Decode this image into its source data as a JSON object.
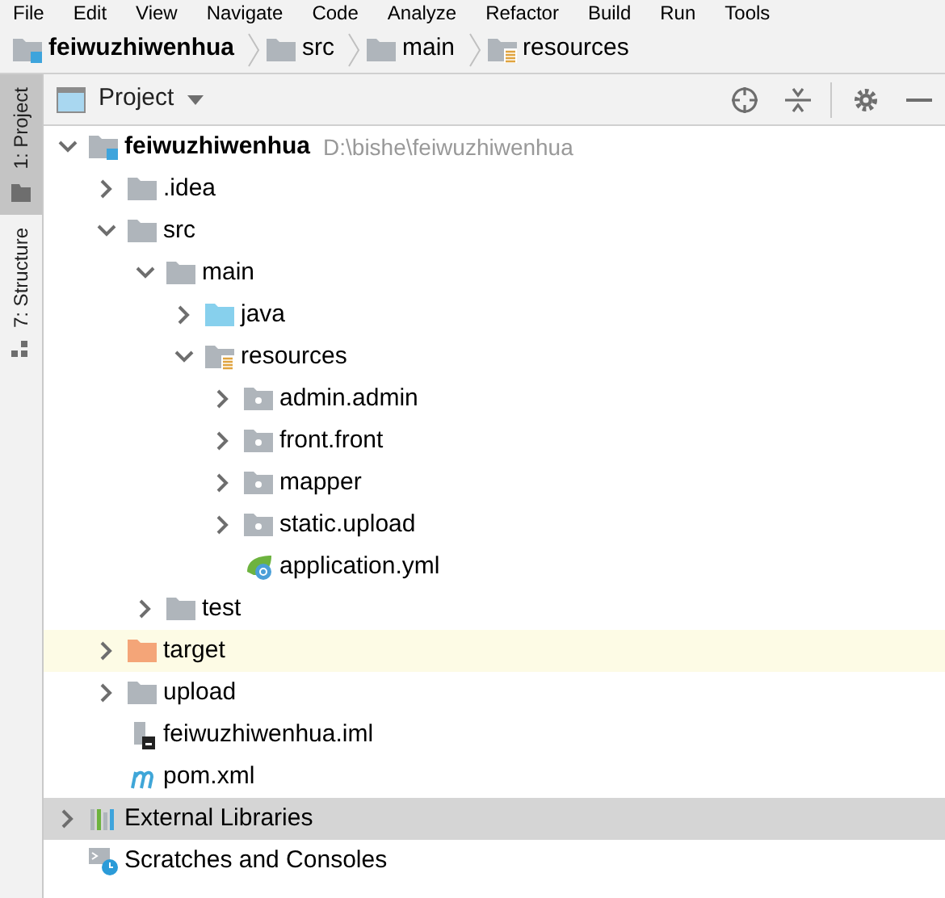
{
  "menu_bar": [
    "File",
    "Edit",
    "View",
    "Navigate",
    "Code",
    "Analyze",
    "Refactor",
    "Build",
    "Run",
    "Tools"
  ],
  "breadcrumbs": [
    {
      "label": "feiwuzhiwenhua",
      "kind": "module"
    },
    {
      "label": "src",
      "kind": "folder"
    },
    {
      "label": "main",
      "kind": "folder"
    },
    {
      "label": "resources",
      "kind": "resources"
    }
  ],
  "side_tabs": [
    {
      "label": "1: Project",
      "selected": true
    },
    {
      "label": "7: Structure",
      "selected": false
    }
  ],
  "panel": {
    "title": "Project"
  },
  "tree": [
    {
      "label": "feiwuzhiwenhua",
      "path": "D:\\bishe\\feiwuzhiwenhua",
      "kind": "module",
      "expanded": true,
      "selected": false,
      "highlighted": false,
      "children": [
        {
          "label": ".idea",
          "kind": "folder",
          "expanded": false,
          "selected": false,
          "highlighted": false
        },
        {
          "label": "src",
          "kind": "folder",
          "expanded": true,
          "selected": false,
          "highlighted": false,
          "children": [
            {
              "label": "main",
              "kind": "folder",
              "expanded": true,
              "selected": false,
              "highlighted": false,
              "children": [
                {
                  "label": "java",
                  "kind": "source",
                  "expanded": false,
                  "selected": false,
                  "highlighted": false
                },
                {
                  "label": "resources",
                  "kind": "resources",
                  "expanded": true,
                  "selected": false,
                  "highlighted": false,
                  "children": [
                    {
                      "label": "admin.admin",
                      "kind": "package",
                      "expanded": false,
                      "selected": false,
                      "highlighted": false
                    },
                    {
                      "label": "front.front",
                      "kind": "package",
                      "expanded": false,
                      "selected": false,
                      "highlighted": false
                    },
                    {
                      "label": "mapper",
                      "kind": "package",
                      "expanded": false,
                      "selected": false,
                      "highlighted": false
                    },
                    {
                      "label": "static.upload",
                      "kind": "package",
                      "expanded": false,
                      "selected": false,
                      "highlighted": false
                    },
                    {
                      "label": "application.yml",
                      "kind": "spring",
                      "selected": false,
                      "highlighted": false
                    }
                  ]
                }
              ]
            },
            {
              "label": "test",
              "kind": "folder",
              "expanded": false,
              "selected": false,
              "highlighted": false
            }
          ]
        },
        {
          "label": "target",
          "kind": "excluded",
          "expanded": false,
          "selected": false,
          "highlighted": true
        },
        {
          "label": "upload",
          "kind": "folder",
          "expanded": false,
          "selected": false,
          "highlighted": false
        },
        {
          "label": "feiwuzhiwenhua.iml",
          "kind": "iml",
          "selected": false,
          "highlighted": false
        },
        {
          "label": "pom.xml",
          "kind": "maven",
          "selected": false,
          "highlighted": false
        }
      ]
    },
    {
      "label": "External Libraries",
      "kind": "libraries",
      "expanded": false,
      "selected": true,
      "highlighted": false
    },
    {
      "label": "Scratches and Consoles",
      "kind": "scratches",
      "selected": false,
      "highlighted": false
    }
  ]
}
